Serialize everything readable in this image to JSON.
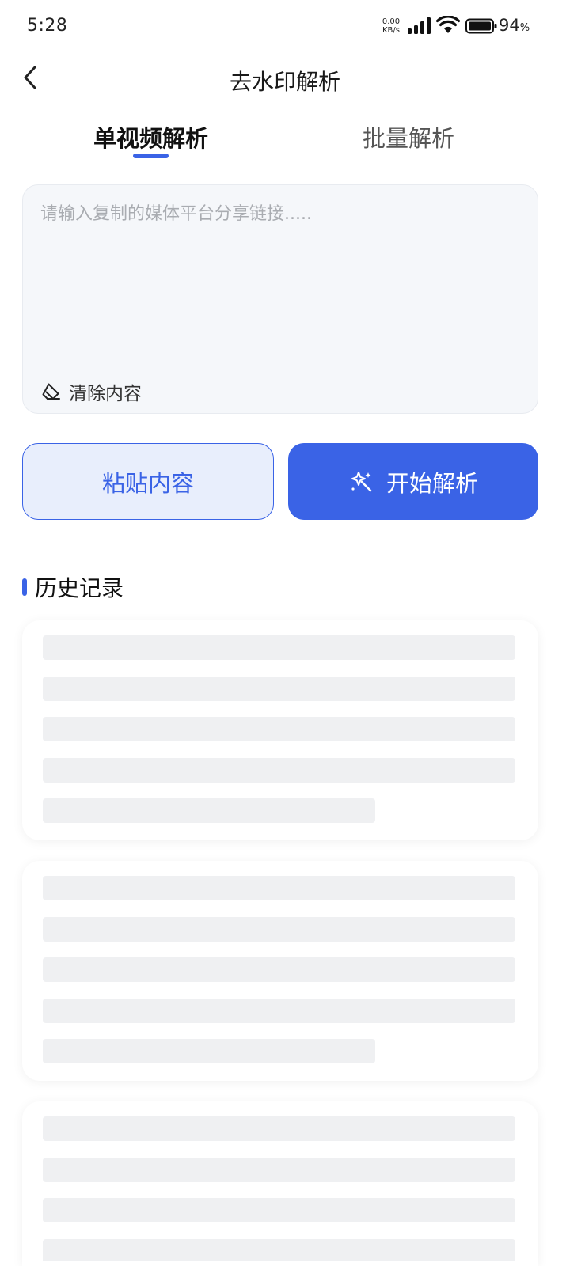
{
  "status_bar": {
    "time": "5:28",
    "net_speed_value": "0.00",
    "net_speed_unit": "KB/s",
    "battery_level": "94",
    "battery_unit": "%"
  },
  "nav": {
    "title": "去水印解析",
    "back_icon": "chevron-left-icon"
  },
  "tabs": [
    {
      "label": "单视频解析",
      "active": true
    },
    {
      "label": "批量解析",
      "active": false
    }
  ],
  "input": {
    "value": "",
    "placeholder": "请输入复制的媒体平台分享链接.....",
    "clear_label": "清除内容",
    "clear_icon": "eraser-icon"
  },
  "actions": {
    "paste_label": "粘贴内容",
    "start_label": "开始解析",
    "start_icon": "magic-wand-icon"
  },
  "history": {
    "title": "历史记录"
  },
  "colors": {
    "accent": "#3a63e6",
    "accent_light": "#e8eefc",
    "input_bg": "#f5f7fa",
    "skeleton": "#eff0f2"
  }
}
